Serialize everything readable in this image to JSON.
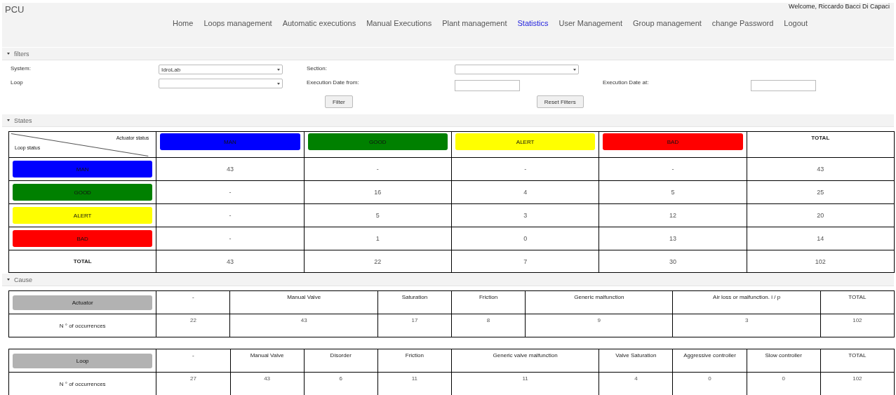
{
  "header": {
    "app_title": "PCU",
    "welcome": "Welcome, Riccardo Bacci Di Capaci"
  },
  "nav": [
    {
      "label": "Home",
      "selected": false
    },
    {
      "label": "Loops management",
      "selected": false
    },
    {
      "label": "Automatic executions",
      "selected": false
    },
    {
      "label": "Manual Executions",
      "selected": false
    },
    {
      "label": "Plant management",
      "selected": false
    },
    {
      "label": "Statistics",
      "selected": true
    },
    {
      "label": "User Management",
      "selected": false
    },
    {
      "label": "Group management",
      "selected": false
    },
    {
      "label": "change Password",
      "selected": false
    },
    {
      "label": "Logout",
      "selected": false
    }
  ],
  "filters": {
    "title": "filters",
    "expanded": true,
    "fields": [
      {
        "kind": "select",
        "label": "System:",
        "value": "IdroLab"
      },
      {
        "kind": "select",
        "label": "Section:"
      },
      {
        "kind": "break"
      },
      {
        "kind": "select",
        "label": "Loop"
      },
      {
        "kind": "input",
        "label": "Execution Date from:"
      },
      {
        "kind": "input",
        "label": "Execution Date at:"
      }
    ],
    "buttons": [
      "Filter",
      "Reset Filters"
    ]
  },
  "states": {
    "title": "States",
    "expanded": true,
    "corner": {
      "column_label": "Actuator status",
      "row_label": "Loop status"
    },
    "columns": [
      {
        "label": "MAN",
        "color": "#0000ff"
      },
      {
        "label": "GOOD",
        "color": "#008000"
      },
      {
        "label": "ALERT",
        "color": "#ffff00"
      },
      {
        "label": "BAD",
        "color": "#ff0000"
      },
      {
        "label": "TOTAL"
      }
    ],
    "rows": [
      {
        "label": "MAN",
        "color": "#0000ff",
        "values": [
          "43",
          "-",
          "-",
          "-",
          "43"
        ]
      },
      {
        "label": "GOOD",
        "color": "#008000",
        "values": [
          "-",
          "16",
          "4",
          "5",
          "25"
        ]
      },
      {
        "label": "ALERT",
        "color": "#ffff00",
        "values": [
          "-",
          "5",
          "3",
          "12",
          "20"
        ]
      },
      {
        "label": "BAD",
        "color": "#ff0000",
        "values": [
          "-",
          "1",
          "0",
          "13",
          "14"
        ]
      },
      {
        "label": "TOTAL",
        "values": [
          "43",
          "22",
          "7",
          "30",
          "102"
        ]
      }
    ]
  },
  "cause": {
    "title": "Cause",
    "expanded": true,
    "tables": [
      {
        "label": "Actuator",
        "row_label": "N ° of occurrences",
        "columns": [
          "-",
          "Manual Valve",
          "Saturation",
          "Friction",
          "Generic malfunction",
          "Air loss or malfunction. i / p",
          "TOTAL"
        ],
        "values": [
          "22",
          "43",
          "17",
          "8",
          "9",
          "3",
          "102"
        ]
      },
      {
        "label": "Loop",
        "row_label": "N ° of occurrences",
        "columns": [
          "-",
          "Manual Valve",
          "Disorder",
          "Friction",
          "Generic valve malfunction",
          "Valve Saturation",
          "Aggressive controller",
          "Slow controller",
          "TOTAL"
        ],
        "values": [
          "27",
          "43",
          "6",
          "11",
          "11",
          "4",
          "0",
          "0",
          "102"
        ]
      }
    ]
  }
}
